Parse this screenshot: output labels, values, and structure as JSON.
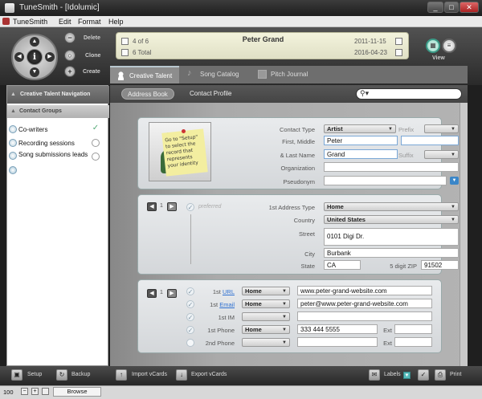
{
  "window": {
    "title": "TuneSmith - [Idolumic]",
    "minimize": "_",
    "maximize": "□",
    "close": "✕"
  },
  "menu": [
    "TuneSmith",
    "Edit",
    "Format",
    "Help"
  ],
  "toolbar": {
    "delete": "Delete",
    "clone": "Clone",
    "create": "Create",
    "view": "View",
    "nav_center": "i"
  },
  "record": {
    "position": "4 of 6",
    "total": "6 Total",
    "name": "Peter Grand",
    "created": "2011-11-15",
    "modified": "2016-04-23"
  },
  "tabs": [
    "Creative Talent",
    "Song Catalog",
    "Pitch Journal"
  ],
  "sidebar": {
    "nav_title": "Creative Talent Navigation",
    "groups_title": "Contact Groups",
    "groups": [
      {
        "label": "Co-writers",
        "checked": "✓"
      },
      {
        "label": "Recording sessions",
        "checked": ""
      },
      {
        "label": "Song submissions leads",
        "checked": ""
      }
    ]
  },
  "subtabs": [
    "Address Book",
    "Contact Profile"
  ],
  "contact": {
    "labels": {
      "type": "Contact Type",
      "first": "First, Middle",
      "last": "& Last Name",
      "org": "Organization",
      "pseudo": "Pseudonym",
      "prefix": "Prefix",
      "suffix": "Suffix"
    },
    "type": "Artist",
    "first": "Peter",
    "middle": "",
    "last": "Grand",
    "organization": "",
    "pseudonym": "",
    "note": "Go to \"Setup\" to select the record that represents your identity"
  },
  "address": {
    "index": "1",
    "preferred": "preferred",
    "labels": {
      "type": "1st Address Type",
      "country": "Country",
      "street": "Street",
      "city": "City",
      "state": "State",
      "zip": "5 digit ZIP"
    },
    "type": "Home",
    "country": "United States",
    "street": "0101 Digi Dr.",
    "city": "Burbank",
    "state": "CA",
    "zip": "91502"
  },
  "contact_methods": {
    "index": "1",
    "rows": [
      {
        "label": "1st",
        "label_link": "URL",
        "type": "Home",
        "value": "www.peter-grand-website.com",
        "ext": ""
      },
      {
        "label": "1st",
        "label_link": "Email",
        "type": "Home",
        "value": "peter@www.peter-grand-website.com",
        "ext": ""
      },
      {
        "label": "1st IM",
        "label_link": "",
        "type": "",
        "value": "",
        "ext": ""
      },
      {
        "label": "1st Phone",
        "label_link": "",
        "type": "Home",
        "value": "333 444 5555",
        "ext": "Ext"
      },
      {
        "label": "2nd Phone",
        "label_link": "",
        "type": "",
        "value": "",
        "ext": "Ext"
      }
    ]
  },
  "footer": {
    "setup": "Setup",
    "backup": "Backup",
    "import": "Import vCards",
    "export": "Export vCards",
    "labels": "Labels",
    "print": "Print"
  },
  "status": {
    "zoom": "100",
    "mode": "Browse"
  }
}
